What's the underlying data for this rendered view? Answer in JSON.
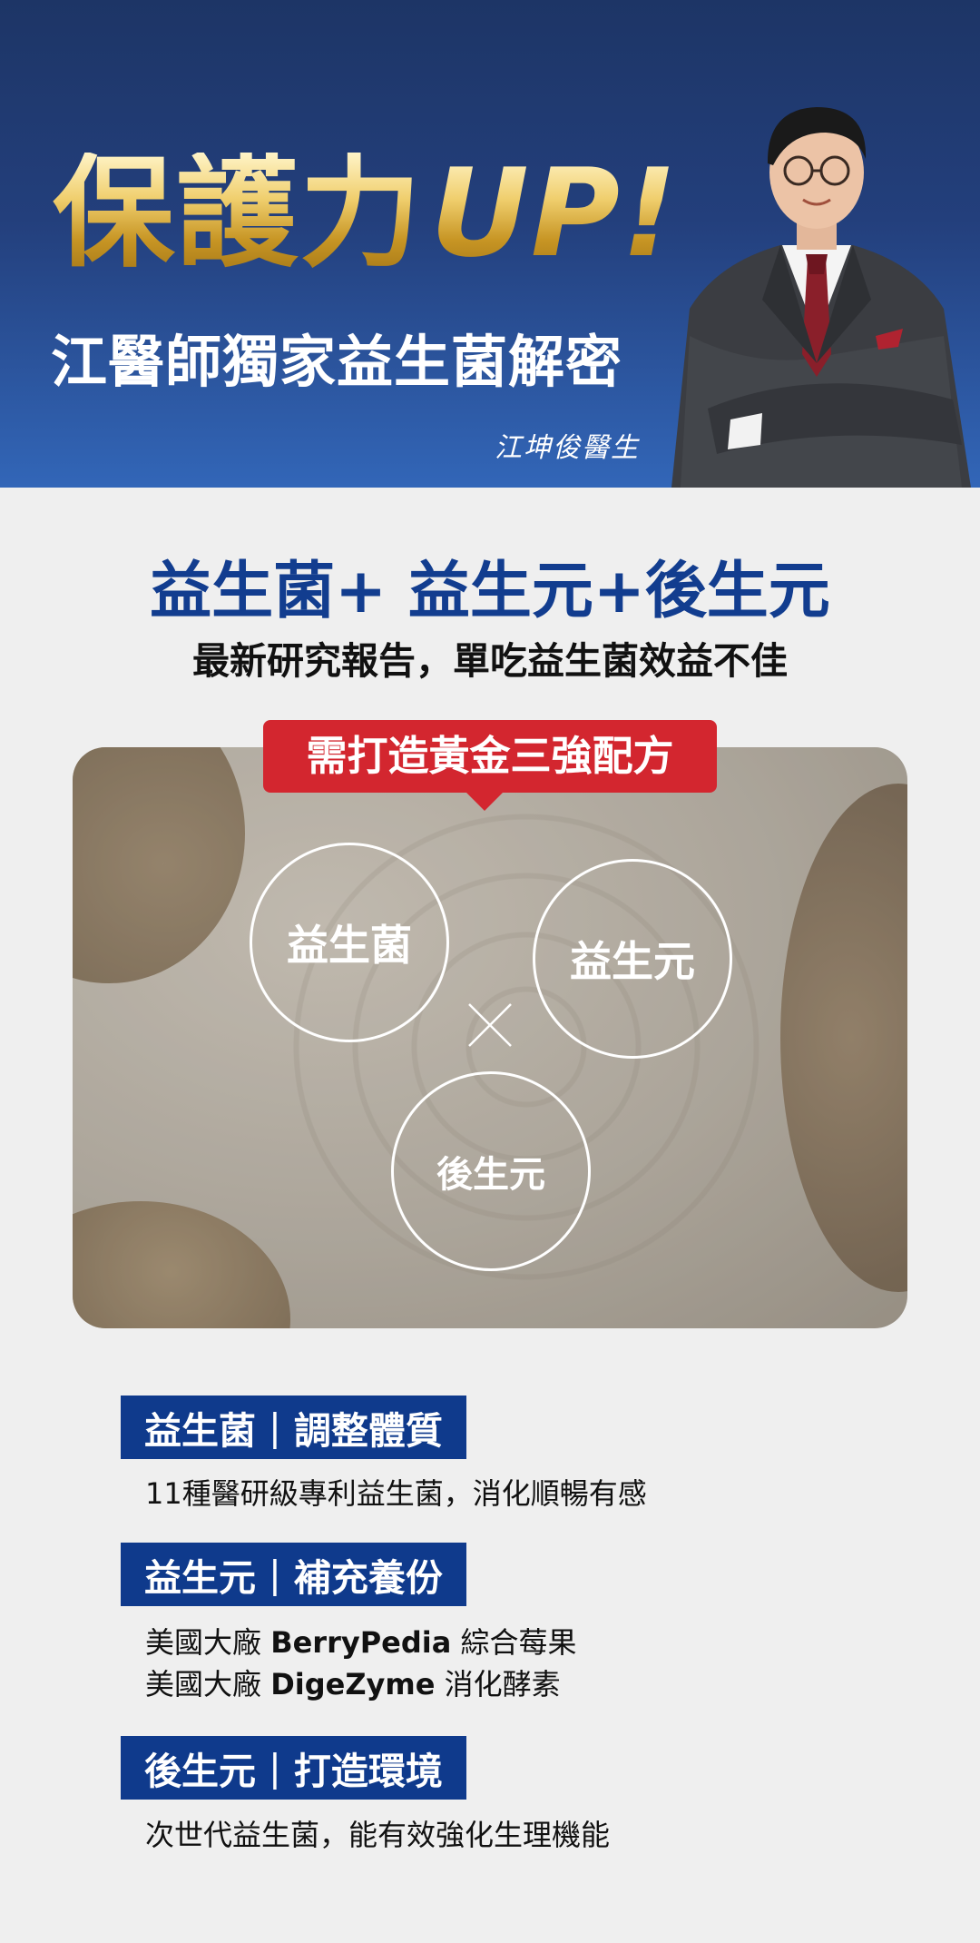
{
  "hero": {
    "headline_main": "保護力",
    "headline_accent": "UP!",
    "subhead": "江醫師獨家益生菌解密",
    "signature": "江坤俊醫生"
  },
  "intro": {
    "title": "益生菌+ 益生元+後生元",
    "subtitle": "最新研究報告，單吃益生菌效益不佳"
  },
  "formula": {
    "ribbon": "需打造黃金三強配方",
    "circle_probiotic": "益生菌",
    "circle_prebiotic": "益生元",
    "circle_postbiotic": "後生元"
  },
  "details": [
    {
      "tag_name": "益生菌",
      "tag_separator": "|",
      "tag_benefit": "調整體質",
      "line1": "11種醫研級專利益生菌，消化順暢有感"
    },
    {
      "tag_name": "益生元",
      "tag_separator": "|",
      "tag_benefit": "補充養份",
      "line1_prefix": "美國大廠 ",
      "line1_brand": "BerryPedia",
      "line1_suffix": " 綜合莓果",
      "line2_prefix": "美國大廠 ",
      "line2_brand": "DigeZyme",
      "line2_suffix": " 消化酵素"
    },
    {
      "tag_name": "後生元",
      "tag_separator": "|",
      "tag_benefit": "打造環境",
      "line1": "次世代益生菌，能有效強化生理機能"
    }
  ],
  "colors": {
    "hero_top": "#1d3566",
    "hero_bottom": "#3266b8",
    "gold": "#d9a93a",
    "brand_blue": "#0f3a8c",
    "ribbon_red": "#d3262f",
    "page_bg": "#efefef"
  }
}
